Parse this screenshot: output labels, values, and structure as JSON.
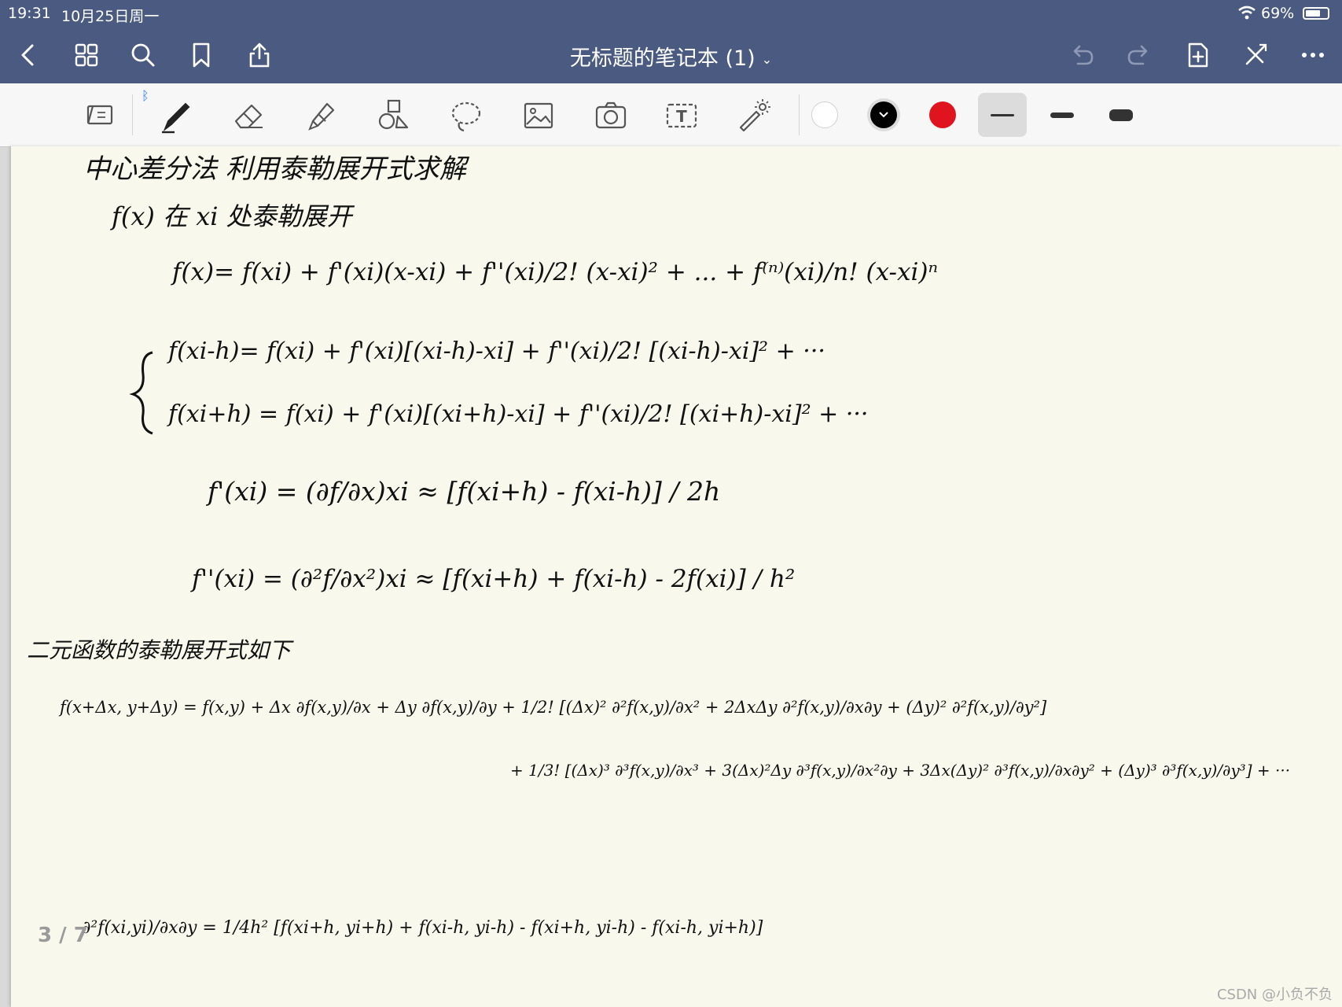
{
  "status": {
    "time": "19:31",
    "date": "10月25日周一",
    "battery_percent": "69%",
    "battery_level": 0.69
  },
  "nav": {
    "title": "无标题的笔记本 (1)",
    "title_chevron": "⌄"
  },
  "toolbar": {
    "bluetooth_mark": "ᛒ",
    "text_tool_glyph": "T",
    "colors": [
      "#ffffff",
      "#000000",
      "#e0141e"
    ],
    "selected_color_index": 1,
    "stroke_widths": [
      "thin",
      "medium",
      "thick"
    ],
    "selected_stroke_index": 0
  },
  "page": {
    "indicator": "3 / 7"
  },
  "notes": [
    "中心差分法  利用泰勒展开式求解",
    "f(x) 在 xi 处泰勒展开",
    "f(x)= f(xi) + f'(xi)(x-xi) + f''(xi)/2! (x-xi)² + ... + f⁽ⁿ⁾(xi)/n! (x-xi)ⁿ",
    "f(xi-h)= f(xi) + f'(xi)[(xi-h)-xi] + f''(xi)/2! [(xi-h)-xi]² + ···",
    "f(xi+h) = f(xi) + f'(xi)[(xi+h)-xi] + f''(xi)/2! [(xi+h)-xi]² + ···",
    "f'(xi) = (∂f/∂x)xi ≈ [f(xi+h) - f(xi-h)] / 2h",
    "f''(xi) = (∂²f/∂x²)xi ≈ [f(xi+h) + f(xi-h) - 2f(xi)] / h²",
    "二元函数的泰勒展开式如下",
    "f(x+Δx, y+Δy) = f(x,y) + Δx ∂f(x,y)/∂x + Δy ∂f(x,y)/∂y + 1/2! [(Δx)² ∂²f(x,y)/∂x² + 2ΔxΔy ∂²f(x,y)/∂x∂y + (Δy)² ∂²f(x,y)/∂y²]",
    "+ 1/3! [(Δx)³ ∂³f(x,y)/∂x³ + 3(Δx)²Δy ∂³f(x,y)/∂x²∂y + 3Δx(Δy)² ∂³f(x,y)/∂x∂y² + (Δy)³ ∂³f(x,y)/∂y³] + ···",
    "∂²f(xi,yi)/∂x∂y = 1/4h² [f(xi+h, yi+h) + f(xi-h, yi-h) - f(xi+h, yi-h) - f(xi-h, yi+h)]"
  ],
  "watermark": "CSDN @小负不负"
}
